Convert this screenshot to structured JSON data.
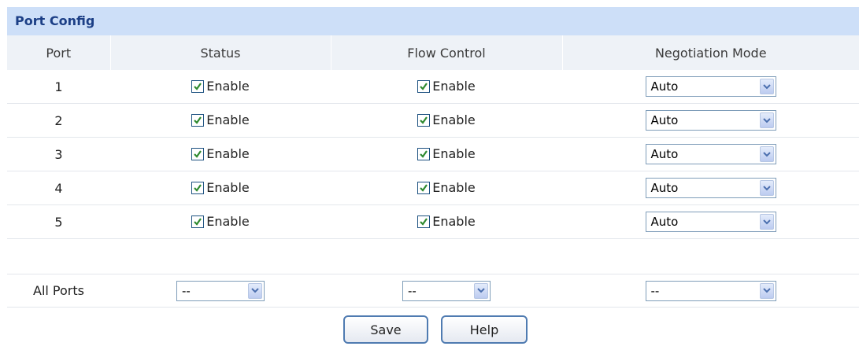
{
  "panel": {
    "title": "Port Config"
  },
  "headers": {
    "port": "Port",
    "status": "Status",
    "flow_control": "Flow Control",
    "negotiation_mode": "Negotiation Mode"
  },
  "rows": [
    {
      "port": "1",
      "status_label": "Enable",
      "status_checked": true,
      "flow_label": "Enable",
      "flow_checked": true,
      "mode": "Auto"
    },
    {
      "port": "2",
      "status_label": "Enable",
      "status_checked": true,
      "flow_label": "Enable",
      "flow_checked": true,
      "mode": "Auto"
    },
    {
      "port": "3",
      "status_label": "Enable",
      "status_checked": true,
      "flow_label": "Enable",
      "flow_checked": true,
      "mode": "Auto"
    },
    {
      "port": "4",
      "status_label": "Enable",
      "status_checked": true,
      "flow_label": "Enable",
      "flow_checked": true,
      "mode": "Auto"
    },
    {
      "port": "5",
      "status_label": "Enable",
      "status_checked": true,
      "flow_label": "Enable",
      "flow_checked": true,
      "mode": "Auto"
    }
  ],
  "all_ports": {
    "label": "All Ports",
    "status_value": "--",
    "flow_value": "--",
    "mode_value": "--"
  },
  "buttons": {
    "save": "Save",
    "help": "Help"
  },
  "colors": {
    "title_bg": "#cddff8",
    "title_text": "#1c3f86",
    "header_bg": "#eef2f7",
    "check_mark": "#2f8a2f"
  }
}
